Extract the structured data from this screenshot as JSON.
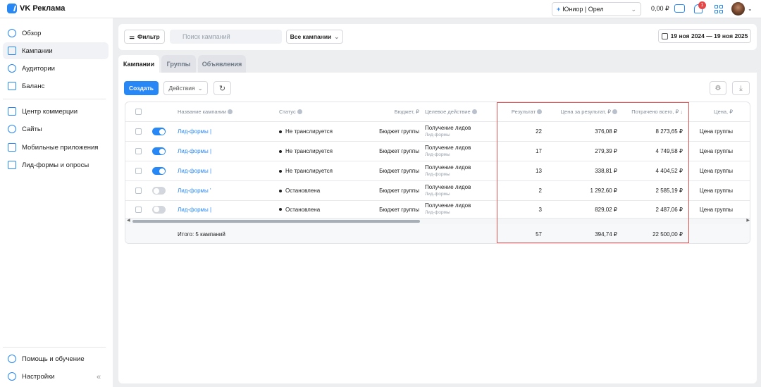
{
  "app": {
    "name": "VK Реклама"
  },
  "topbar": {
    "account": "Юниор | Орел",
    "balance": "0,00 ₽",
    "notifications_count": "1"
  },
  "sidebar": {
    "items": [
      {
        "label": "Обзор"
      },
      {
        "label": "Кампании"
      },
      {
        "label": "Аудитории"
      },
      {
        "label": "Баланс"
      },
      {
        "label": "Центр коммерции"
      },
      {
        "label": "Сайты"
      },
      {
        "label": "Мобильные приложения"
      },
      {
        "label": "Лид-формы и опросы"
      }
    ],
    "bottom": [
      {
        "label": "Помощь и обучение"
      },
      {
        "label": "Настройки"
      }
    ]
  },
  "filters": {
    "filter_label": "Фильтр",
    "search_placeholder": "Поиск кампаний",
    "campaigns_select": "Все кампании",
    "date_range": "19 ноя 2024 — 19 ноя 2025"
  },
  "tabs": [
    {
      "label": "Кампании"
    },
    {
      "label": "Группы"
    },
    {
      "label": "Объявления"
    }
  ],
  "toolbar": {
    "create": "Создать",
    "actions": "Действия"
  },
  "table": {
    "headers": {
      "name": "Название кампании",
      "status": "Статус",
      "budget": "Бюджет, ₽",
      "target": "Целевое действие",
      "result": "Результат",
      "price": "Цена за результат, ₽",
      "spent": "Потрачено всего, ₽",
      "price2": "Цена, ₽"
    },
    "rows": [
      {
        "name": "Лид-формы |",
        "status": "Не транслируется",
        "budget": "Бюджет группы",
        "target": "Получение лидов",
        "target_sub": "Лид-формы",
        "result": "22",
        "price": "376,08 ₽",
        "spent": "8 273,65 ₽",
        "price2": "Цена группы",
        "enabled": true
      },
      {
        "name": "Лид-формы |",
        "status": "Не транслируется",
        "budget": "Бюджет группы",
        "target": "Получение лидов",
        "target_sub": "Лид-формы",
        "result": "17",
        "price": "279,39 ₽",
        "spent": "4 749,58 ₽",
        "price2": "Цена группы",
        "enabled": true
      },
      {
        "name": "Лид-формы |",
        "status": "Не транслируется",
        "budget": "Бюджет группы",
        "target": "Получение лидов",
        "target_sub": "Лид-формы",
        "result": "13",
        "price": "338,81 ₽",
        "spent": "4 404,52 ₽",
        "price2": "Цена группы",
        "enabled": true
      },
      {
        "name": "Лид-формы '",
        "status": "Остановлена",
        "budget": "Бюджет группы",
        "target": "Получение лидов",
        "target_sub": "Лид-формы",
        "result": "2",
        "price": "1 292,60 ₽",
        "spent": "2 585,19 ₽",
        "price2": "Цена группы",
        "enabled": false
      },
      {
        "name": "Лид-формы |",
        "status": "Остановлена",
        "budget": "Бюджет группы",
        "target": "Получение лидов",
        "target_sub": "Лид-формы",
        "result": "3",
        "price": "829,02 ₽",
        "spent": "2 487,06 ₽",
        "price2": "Цена группы",
        "enabled": false
      }
    ],
    "totals": {
      "label": "Итого: 5 кампаний",
      "result": "57",
      "price": "394,74 ₽",
      "spent": "22 500,00 ₽"
    }
  },
  "colors": {
    "accent": "#2787f5",
    "highlight": "#e45454"
  }
}
